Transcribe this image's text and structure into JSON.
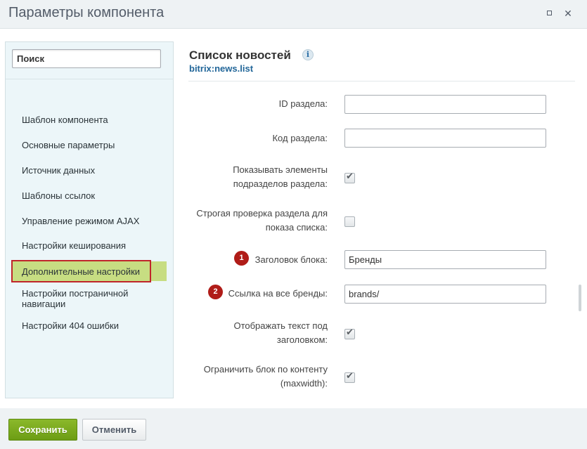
{
  "window": {
    "title": "Параметры компонента"
  },
  "sidebar": {
    "search_placeholder": "Поиск",
    "items": [
      {
        "label": "Шаблон компонента"
      },
      {
        "label": "Основные параметры"
      },
      {
        "label": "Источник данных"
      },
      {
        "label": "Шаблоны ссылок"
      },
      {
        "label": "Управление режимом AJAX"
      },
      {
        "label": "Настройки кеширования"
      },
      {
        "label": "Дополнительные настройки",
        "active": true
      },
      {
        "label": "Настройки постраничной навигации"
      },
      {
        "label": "Настройки 404 ошибки"
      }
    ]
  },
  "component": {
    "title": "Список новостей",
    "code": "bitrix:news.list",
    "info_icon_glyph": "i"
  },
  "fields": {
    "section_id": {
      "label": "ID раздела:",
      "value": ""
    },
    "section_code": {
      "label": "Код раздела:",
      "value": ""
    },
    "show_subsections": {
      "label_line1": "Показывать элементы",
      "label_line2": "подразделов раздела:",
      "checked": true
    },
    "strict_check": {
      "label_line1": "Строгая проверка раздела для",
      "label_line2": "показа списка:",
      "checked": false
    },
    "block_title": {
      "label": "Заголовок блока:",
      "value": "Бренды",
      "badge": "1"
    },
    "all_brands_link": {
      "label": "Ссылка на все бренды:",
      "value": "brands/",
      "badge": "2"
    },
    "show_text": {
      "label_line1": "Отображать текст под",
      "label_line2": "заголовком:",
      "checked": true
    },
    "limit_block": {
      "label_line1": "Ограничить блок по контенту",
      "label_line2": "(maxwidth):",
      "checked": true
    }
  },
  "footer": {
    "save_label": "Сохранить",
    "cancel_label": "Отменить"
  },
  "colors": {
    "accent_green": "#6c9d14",
    "active_item": "#c7dd82",
    "highlight_border": "#c0252a",
    "badge": "#b01c18",
    "code_link": "#226699"
  }
}
